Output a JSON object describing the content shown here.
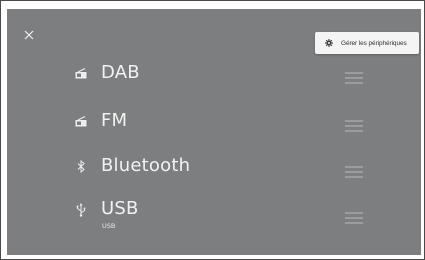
{
  "header": {
    "close_icon": "close-icon",
    "manage_button": {
      "icon": "gear-icon",
      "label": "Gérer les périphériques"
    }
  },
  "sources": [
    {
      "name": "DAB",
      "icon": "radio-icon",
      "sub": ""
    },
    {
      "name": "FM",
      "icon": "radio-icon",
      "sub": ""
    },
    {
      "name": "Bluetooth",
      "icon": "bluetooth-icon",
      "sub": ""
    },
    {
      "name": "USB",
      "icon": "usb-icon",
      "sub": "USB"
    }
  ],
  "colors": {
    "background": "#7d7e80",
    "text": "#f2f2f2",
    "handle": "#9b9c9e",
    "button": "#f4f4f4"
  }
}
